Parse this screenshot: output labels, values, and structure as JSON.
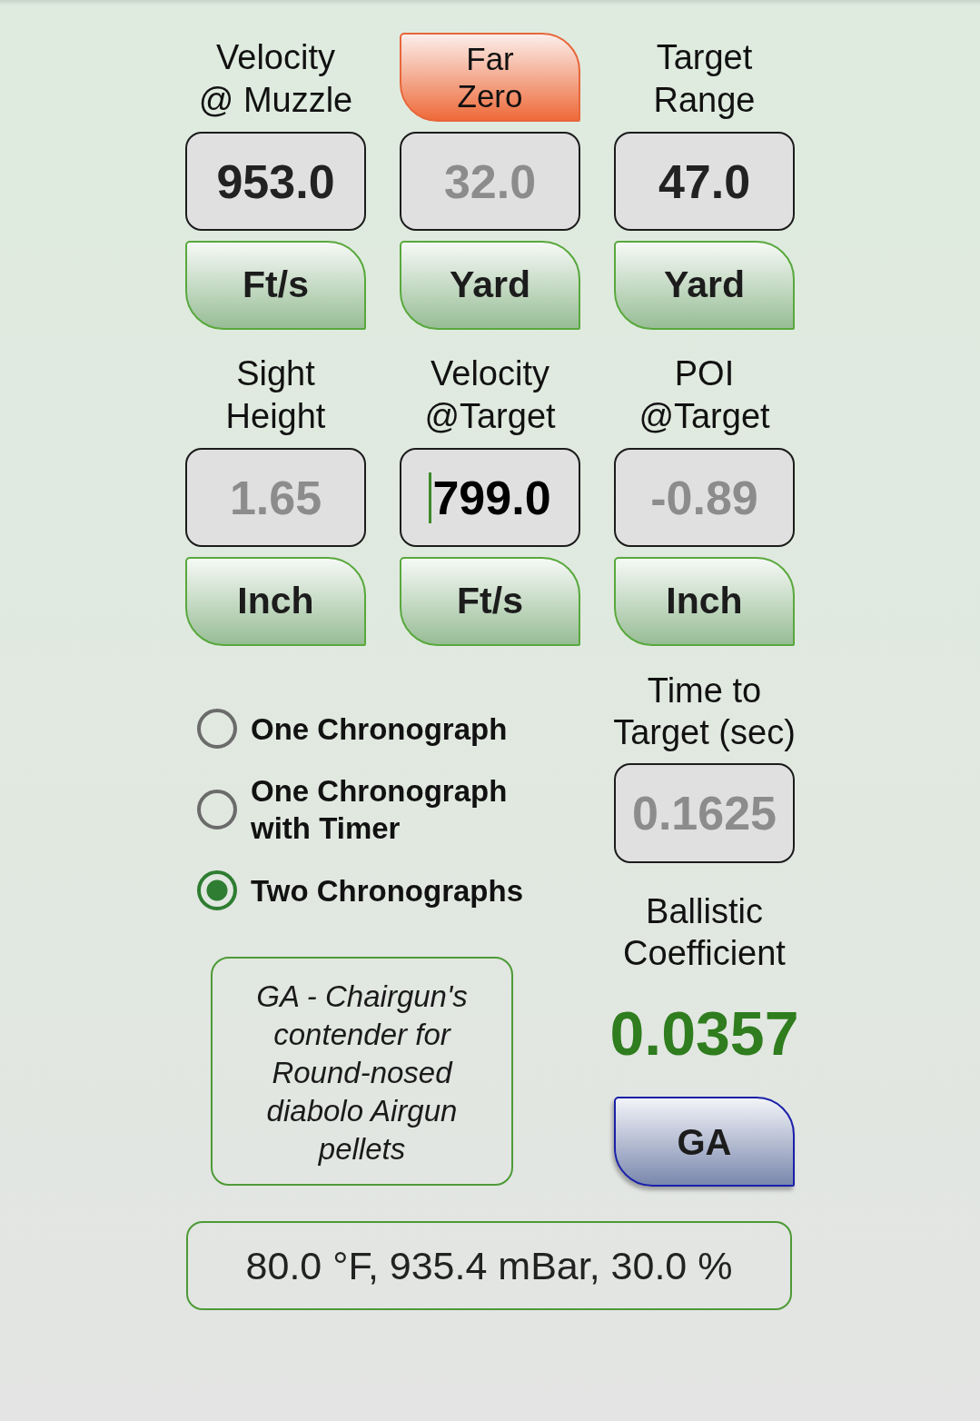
{
  "parameters": [
    {
      "header": {
        "kind": "label",
        "text": "Velocity\n@ Muzzle"
      },
      "value": "953.0",
      "disabled": false,
      "focused": false,
      "unit": "Ft/s"
    },
    {
      "header": {
        "kind": "button",
        "text": "Far\nZero"
      },
      "value": "32.0",
      "disabled": true,
      "focused": false,
      "unit": "Yard"
    },
    {
      "header": {
        "kind": "label",
        "text": "Target\nRange"
      },
      "value": "47.0",
      "disabled": false,
      "focused": false,
      "unit": "Yard"
    },
    {
      "header": {
        "kind": "label",
        "text": "Sight\nHeight"
      },
      "value": "1.65",
      "disabled": true,
      "focused": false,
      "unit": "Inch"
    },
    {
      "header": {
        "kind": "label",
        "text": "Velocity\n@Target"
      },
      "value": "799.0",
      "disabled": false,
      "focused": true,
      "unit": "Ft/s"
    },
    {
      "header": {
        "kind": "label",
        "text": "POI\n@Target"
      },
      "value": "-0.89",
      "disabled": true,
      "focused": false,
      "unit": "Inch"
    }
  ],
  "chronograph_modes": [
    {
      "label": "One Chronograph",
      "selected": false
    },
    {
      "label": "One Chronograph\nwith Timer",
      "selected": false
    },
    {
      "label": "Two Chronographs",
      "selected": true
    }
  ],
  "time_to_target": {
    "label": "Time to\nTarget (sec)",
    "value": "0.1625",
    "disabled": true
  },
  "ballistic_coefficient": {
    "label": "Ballistic\nCoefficient",
    "value": "0.0357"
  },
  "drag_model_button": "GA",
  "drag_model_description": "GA - Chairgun's\ncontender for\nRound-nosed\ndiabolo Airgun\npellets",
  "conditions": "80.0 °F, 935.4 mBar, 30.0 %"
}
